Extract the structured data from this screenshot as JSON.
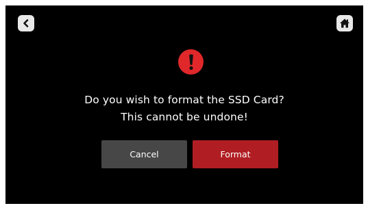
{
  "dialog": {
    "line1": "Do you wish to format the SSD Card?",
    "line2": "This cannot be undone!",
    "cancel_label": "Cancel",
    "format_label": "Format"
  },
  "icons": {
    "back": "chevron-left-icon",
    "home": "home-icon",
    "alert": "exclamation-icon"
  },
  "colors": {
    "background": "#000000",
    "alert": "#e0282b",
    "cancel_button": "#474747",
    "format_button": "#b01e23",
    "nav_button": "#e8e8e8"
  }
}
